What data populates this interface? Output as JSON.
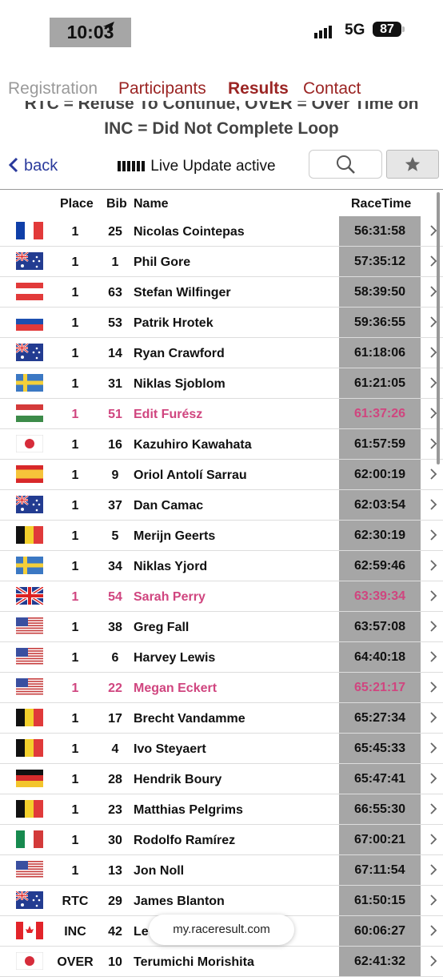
{
  "status_bar": {
    "time": "10:03",
    "network": "5G",
    "battery": "87"
  },
  "nav_tabs": [
    {
      "label": "Registration",
      "color": "#9a9a9a"
    },
    {
      "label": "Participants",
      "color": "#9b2524"
    },
    {
      "label": "Results",
      "color": "#9b2524"
    },
    {
      "label": "Contact",
      "color": "#9b2524"
    }
  ],
  "legend": {
    "line1": "RTC = Refuse To Continue, OVER = Over Time on Loop,",
    "line2": "INC = Did Not Complete Loop"
  },
  "toolbar": {
    "back_label": "back",
    "live_label": "Live Update active"
  },
  "table": {
    "headers": {
      "place": "Place",
      "bib": "Bib",
      "name": "Name",
      "racetime": "RaceTime"
    },
    "rows": [
      {
        "flag": "fr",
        "place": "1",
        "bib": "25",
        "name": "Nicolas Cointepas",
        "time": "56:31:58",
        "female": false
      },
      {
        "flag": "au",
        "place": "1",
        "bib": "1",
        "name": "Phil Gore",
        "time": "57:35:12",
        "female": false
      },
      {
        "flag": "at",
        "place": "1",
        "bib": "63",
        "name": "Stefan Wilfinger",
        "time": "58:39:50",
        "female": false
      },
      {
        "flag": "sk",
        "place": "1",
        "bib": "53",
        "name": "Patrik Hrotek",
        "time": "59:36:55",
        "female": false
      },
      {
        "flag": "au",
        "place": "1",
        "bib": "14",
        "name": "Ryan Crawford",
        "time": "61:18:06",
        "female": false
      },
      {
        "flag": "se",
        "place": "1",
        "bib": "31",
        "name": "Niklas Sjoblom",
        "time": "61:21:05",
        "female": false
      },
      {
        "flag": "hu",
        "place": "1",
        "bib": "51",
        "name": "Edit Furész",
        "time": "61:37:26",
        "female": true
      },
      {
        "flag": "jp",
        "place": "1",
        "bib": "16",
        "name": "Kazuhiro Kawahata",
        "time": "61:57:59",
        "female": false
      },
      {
        "flag": "es",
        "place": "1",
        "bib": "9",
        "name": "Oriol Antolí Sarrau",
        "time": "62:00:19",
        "female": false
      },
      {
        "flag": "au",
        "place": "1",
        "bib": "37",
        "name": "Dan Camac",
        "time": "62:03:54",
        "female": false
      },
      {
        "flag": "be",
        "place": "1",
        "bib": "5",
        "name": "Merijn Geerts",
        "time": "62:30:19",
        "female": false
      },
      {
        "flag": "se",
        "place": "1",
        "bib": "34",
        "name": "Niklas Yjord",
        "time": "62:59:46",
        "female": false
      },
      {
        "flag": "gb",
        "place": "1",
        "bib": "54",
        "name": "Sarah Perry",
        "time": "63:39:34",
        "female": true
      },
      {
        "flag": "us",
        "place": "1",
        "bib": "38",
        "name": "Greg Fall",
        "time": "63:57:08",
        "female": false
      },
      {
        "flag": "us",
        "place": "1",
        "bib": "6",
        "name": "Harvey Lewis",
        "time": "64:40:18",
        "female": false
      },
      {
        "flag": "us",
        "place": "1",
        "bib": "22",
        "name": "Megan Eckert",
        "time": "65:21:17",
        "female": true
      },
      {
        "flag": "be",
        "place": "1",
        "bib": "17",
        "name": "Brecht Vandamme",
        "time": "65:27:34",
        "female": false
      },
      {
        "flag": "be",
        "place": "1",
        "bib": "4",
        "name": "Ivo Steyaert",
        "time": "65:45:33",
        "female": false
      },
      {
        "flag": "de",
        "place": "1",
        "bib": "28",
        "name": "Hendrik Boury",
        "time": "65:47:41",
        "female": false
      },
      {
        "flag": "be",
        "place": "1",
        "bib": "23",
        "name": "Matthias Pelgrims",
        "time": "66:55:30",
        "female": false
      },
      {
        "flag": "mx",
        "place": "1",
        "bib": "30",
        "name": "Rodolfo Ramírez",
        "time": "67:00:21",
        "female": false
      },
      {
        "flag": "us",
        "place": "1",
        "bib": "13",
        "name": "Jon Noll",
        "time": "67:11:54",
        "female": false
      },
      {
        "flag": "au",
        "place": "RTC",
        "bib": "29",
        "name": "James Blanton",
        "time": "61:50:15",
        "female": false
      },
      {
        "flag": "ca",
        "place": "INC",
        "bib": "42",
        "name": "Lee",
        "time": "60:06:27",
        "female": false
      },
      {
        "flag": "jp",
        "place": "OVER",
        "bib": "10",
        "name": "Terumichi Morishita",
        "time": "62:41:32",
        "female": false
      }
    ]
  },
  "url_pill": "my.raceresult.com"
}
